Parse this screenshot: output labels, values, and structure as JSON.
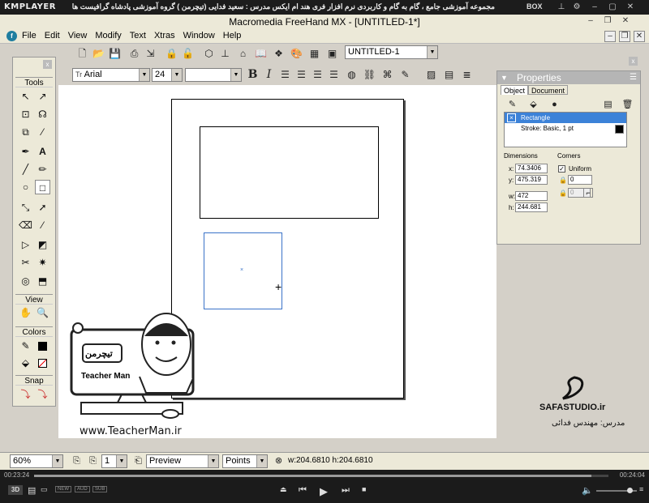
{
  "player": {
    "logo": "KMPLAYER",
    "caption": "مجموعه آموزشی جامع ، گام به گام و کاربردی نرم افزار فری هند ام ایکس   مدرس : سعید فدایی (تیچرمن ) گروه آموزشی پادشاه گرافیست ها",
    "box_label": "BOX",
    "time_elapsed": "00:23:24",
    "time_total": "00:24:04",
    "mode_label": "3D",
    "badges": [
      "NEW",
      "AUD",
      "SUB"
    ]
  },
  "app": {
    "title": "Macromedia FreeHand MX - [UNTITLED-1*]",
    "menu": [
      "File",
      "Edit",
      "View",
      "Modify",
      "Text",
      "Xtras",
      "Window",
      "Help"
    ],
    "document_select": "UNTITLED-1",
    "font_select": "Arial",
    "size_select": "24",
    "style_select": ""
  },
  "tools": {
    "title": "Tools",
    "view_title": "View",
    "colors_title": "Colors",
    "snap_title": "Snap"
  },
  "properties": {
    "title": "Properties",
    "tabs": [
      "Object",
      "Document"
    ],
    "object_name": "Rectangle",
    "stroke_label": "Stroke: Basic, 1 pt",
    "dimensions_label": "Dimensions",
    "corners_label": "Corners",
    "x_value": "74.3406",
    "y_value": "475.319",
    "w_value": "472",
    "h_value": "244.681",
    "uniform_label": "Uniform",
    "corner_value": "0",
    "corner_value2": "0"
  },
  "status": {
    "zoom": "60%",
    "page_num": "1",
    "view_mode": "Preview",
    "units": "Points",
    "size_readout": "w:204.6810   h:204.6810"
  },
  "watermark": {
    "url": "www.TeacherMan.ir",
    "logo_text": "Teacher Man",
    "studio": "SAFASTUDIO.ir",
    "teacher": "مدرس: مهندس فدائی"
  }
}
